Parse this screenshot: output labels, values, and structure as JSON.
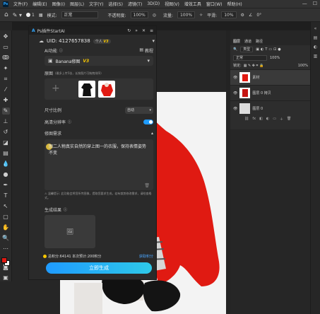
{
  "menubar": {
    "app": "Ps",
    "items": [
      "文件(F)",
      "编辑(E)",
      "图像(I)",
      "图层(L)",
      "文字(Y)",
      "选择(S)",
      "滤镜(T)",
      "3D(D)",
      "视图(V)",
      "增效工具",
      "窗口(W)",
      "帮助(H)"
    ]
  },
  "options": {
    "brush_size": "1",
    "mode_label": "模式:",
    "mode_value": "正常",
    "opacity_label": "不透明度:",
    "opacity_value": "100%",
    "flow_label": "流量:",
    "flow_value": "100%",
    "smooth_label": "平滑:",
    "smooth_value": "10%",
    "angle_value": "0°"
  },
  "plugin": {
    "title": "Ps插件StartAI",
    "uid": "UID: 4127657838",
    "account_type": "个人",
    "version_badge": "V3",
    "ai_function_label": "AI功能",
    "tutorial_label": "教程",
    "model_label": "Banana修图",
    "model_version": "V3",
    "original_label": "原图",
    "original_hint": "(最多上传5张，长按图片可拖拽排序)",
    "aspect_label": "尺寸比例",
    "aspect_value": "自动",
    "hd_label": "高清分辨率",
    "requirement_label": "修图需求",
    "requirement_text": "图二人物真实自然的穿上图一的衣服，保持表情姿势不变",
    "warning_text": "⚠ 温馨提示: 此功能会将您所传图像，提取您要求生成，若有裁剪修改需求，请检查格式。",
    "result_label": "生成结果",
    "points_text": "总积分:64141  本次预计:200积分",
    "get_points": "获取积分",
    "generate_button": "立即生成"
  },
  "panels": {
    "tab_layers": "图层",
    "tab_channels": "通道",
    "tab_paths": "路径",
    "filter_label": "类型",
    "blend_mode": "正常",
    "opacity": "100%",
    "lock_label": "锁定:",
    "fill": "100%",
    "layers": [
      {
        "name": "素材"
      },
      {
        "name": "图层 0 拷贝"
      },
      {
        "name": "图层 0"
      }
    ]
  },
  "colors": {
    "foreground": "#e01a12",
    "background": "#ffffff",
    "accent_gradient_start": "#1f9bff",
    "accent_gradient_end": "#2ec9e8",
    "version_badge": "#f7c600"
  }
}
